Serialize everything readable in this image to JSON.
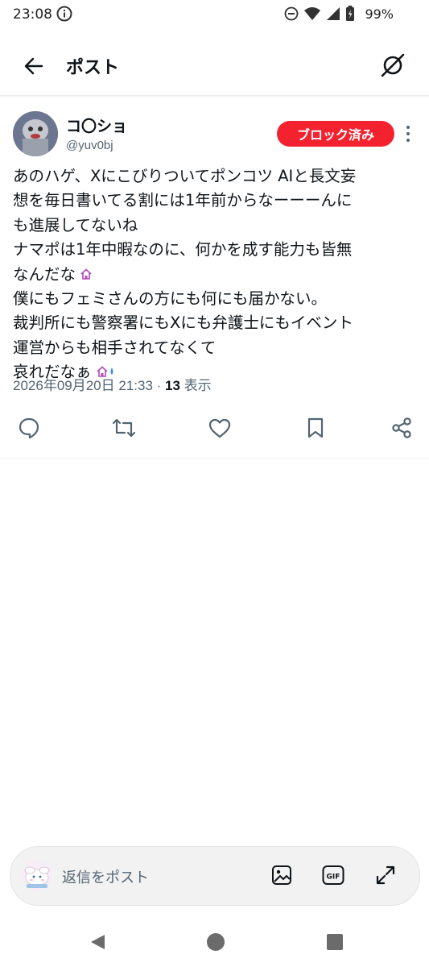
{
  "status_bar": {
    "time": "23:08",
    "battery_percent": "99%",
    "icons": [
      "info-icon",
      "dnd-icon",
      "wifi-icon",
      "signal-icon",
      "battery-icon"
    ]
  },
  "header": {
    "title": "ポスト",
    "back_icon": "arrow-left-icon",
    "grok_icon": "grok-icon"
  },
  "post": {
    "author_name": "コ〇ショ",
    "author_handle": "@yuv0bj",
    "blocked_label": "ブロック済み",
    "lines": [
      "あのハゲ、Xにこびりついてポンコツ AIと長文妄",
      "想を毎日書いてる割には1年前からなーーーんに",
      "も進展してないね",
      "ナマポは1年中暇なのに、何かを成す能力も皆無",
      "なんだな",
      "僕にもフェミさんの方にも何にも届かない。",
      "裁判所にも警察署にもXにも弁護士にもイベント",
      "運営からも相手されてなくて",
      "哀れだなぁ"
    ],
    "timestamp": "2026年09月20日 21:33",
    "separator": " · ",
    "views_count": "13",
    "views_label": " 表示"
  },
  "actions": {
    "icons": [
      "reply-icon",
      "repost-icon",
      "like-icon",
      "bookmark-icon",
      "share-icon"
    ]
  },
  "reply_bar": {
    "placeholder": "返信をポスト",
    "icons": [
      "image-icon",
      "gif-icon",
      "expand-icon"
    ]
  },
  "nav_bar": {
    "icons": [
      "nav-back-icon",
      "nav-home-icon",
      "nav-recents-icon"
    ]
  },
  "colors": {
    "blocked_badge": "#f4212e",
    "text_primary": "#0f1419",
    "text_secondary": "#536471"
  }
}
